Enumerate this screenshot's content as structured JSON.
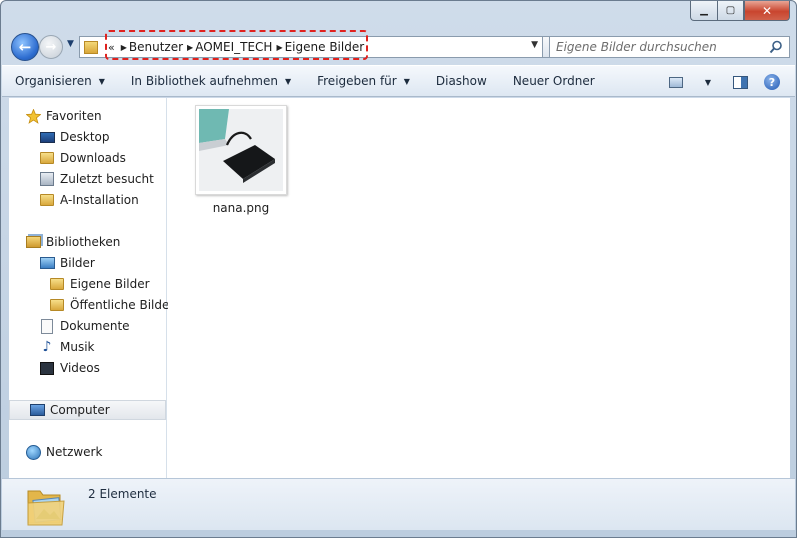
{
  "window": {
    "caption_buttons": {
      "minimize": "▁",
      "maximize": "▢",
      "close": "✕"
    }
  },
  "navigation": {
    "back_icon": "back-arrow-icon",
    "forward_icon": "forward-arrow-icon",
    "recent_icon": "recent-pages-dropdown-icon"
  },
  "address_bar": {
    "overflow": "«",
    "breadcrumbs": [
      "Benutzer",
      "AOMEI_TECH",
      "Eigene Bilder"
    ],
    "highlight_color": "#e0221e"
  },
  "search": {
    "placeholder": "Eigene Bilder durchsuchen"
  },
  "command_bar": {
    "items": [
      {
        "label": "Organisieren",
        "has_dropdown": true
      },
      {
        "label": "In Bibliothek aufnehmen",
        "has_dropdown": true
      },
      {
        "label": "Freigeben für",
        "has_dropdown": true
      },
      {
        "label": "Diashow",
        "has_dropdown": false
      },
      {
        "label": "Neuer Ordner",
        "has_dropdown": false
      }
    ],
    "help": "?"
  },
  "nav_pane": {
    "favorites": {
      "label": "Favoriten",
      "items": [
        "Desktop",
        "Downloads",
        "Zuletzt besucht",
        "A-Installation"
      ]
    },
    "libraries": {
      "label": "Bibliotheken",
      "pictures": "Bilder",
      "pictures_children": [
        "Eigene Bilder",
        "Öffentliche Bilder"
      ],
      "items": [
        "Dokumente",
        "Musik",
        "Videos"
      ]
    },
    "computer": "Computer",
    "network": "Netzwerk"
  },
  "files": [
    {
      "name": "nana.png",
      "icon": "image-thumbnail"
    }
  ],
  "details_pane": {
    "text": "2 Elemente",
    "icon": "pictures-folder-icon"
  },
  "colors": {
    "accent": "#2e6dd0",
    "command_bar_bg": "#e6eef7",
    "selection": "#e3e7ec"
  }
}
